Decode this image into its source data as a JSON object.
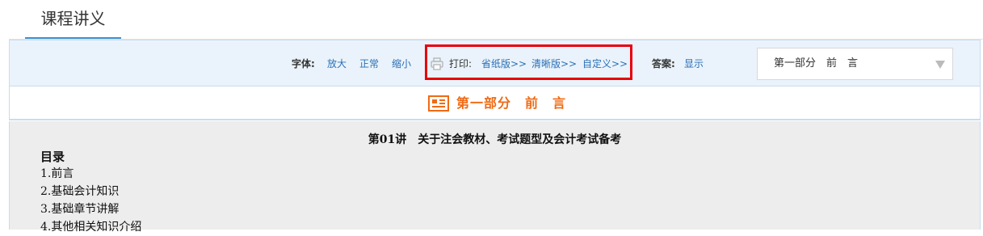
{
  "page": {
    "title": "课程讲义"
  },
  "toolbar": {
    "font_label": "字体:",
    "font_options": [
      "放大",
      "正常",
      "缩小"
    ],
    "print_label": "打印:",
    "print_options": [
      "省纸版>>",
      "清晰版>>",
      "自定义>>"
    ],
    "answer_label": "答案:",
    "answer_link": "显示",
    "section_select": {
      "value": "第一部分　前　言"
    },
    "highlight_color": "#e8000b"
  },
  "section": {
    "title": "第一部分　前　言",
    "icon": "book-icon",
    "color": "#f06a14"
  },
  "content": {
    "lecture_title": "第01讲　关于注会教材、考试题型及会计考试备考",
    "toc_heading": "目录",
    "toc_items": [
      "1.前言",
      "2.基础会计知识",
      "3.基础章节讲解",
      "4.其他相关知识介绍"
    ]
  }
}
